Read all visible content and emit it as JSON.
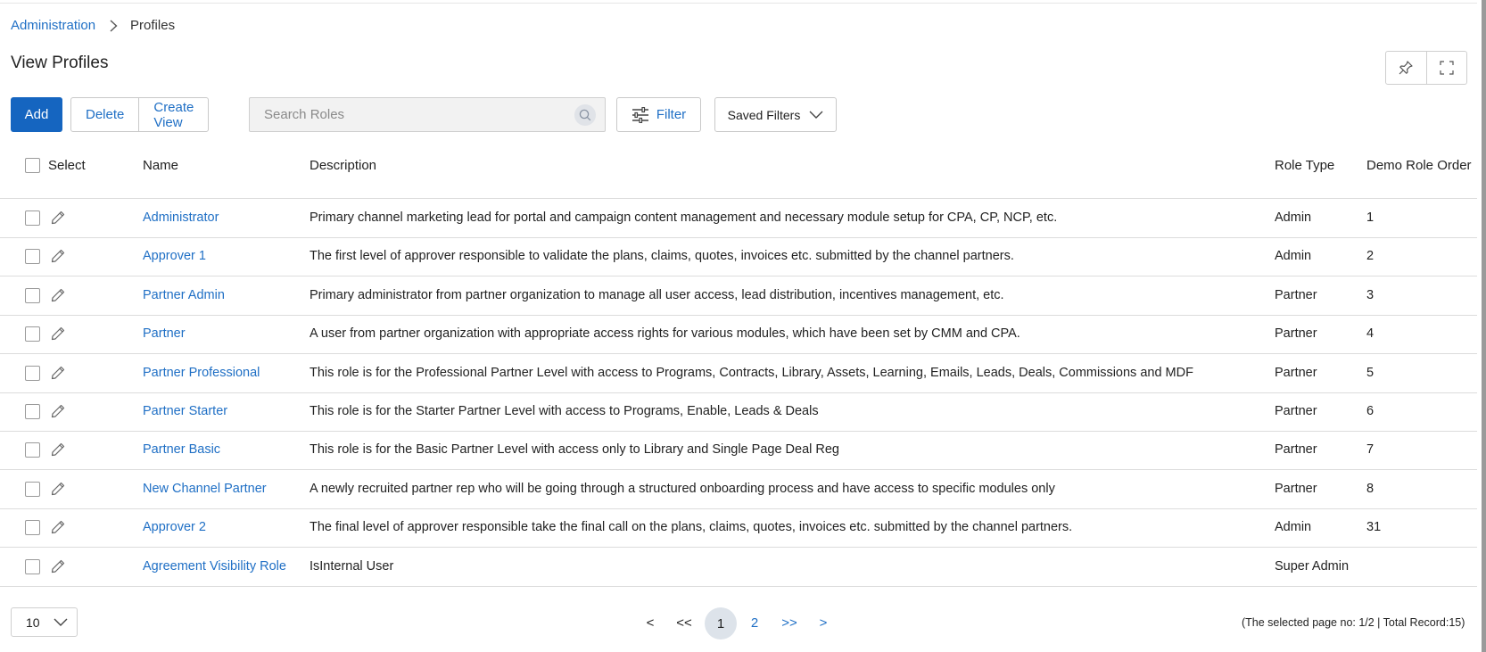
{
  "breadcrumb": {
    "parent": "Administration",
    "current": "Profiles"
  },
  "page_title": "View Profiles",
  "toolbar": {
    "add_label": "Add",
    "delete_label": "Delete",
    "create_view_label": "Create View",
    "search_placeholder": "Search Roles",
    "filter_label": "Filter",
    "saved_filters_label": "Saved Filters"
  },
  "table": {
    "headers": {
      "select": "Select",
      "name": "Name",
      "description": "Description",
      "role_type": "Role Type",
      "demo_role_order": "Demo Role Order"
    },
    "rows": [
      {
        "name": "Administrator",
        "description": "Primary channel marketing lead for portal and campaign content management and necessary module setup for CPA, CP, NCP, etc.",
        "role_type": "Admin",
        "order": "1"
      },
      {
        "name": "Approver 1",
        "description": "The first level of approver responsible to validate the plans, claims, quotes, invoices etc. submitted by the channel partners.",
        "role_type": "Admin",
        "order": "2"
      },
      {
        "name": "Partner Admin",
        "description": "Primary administrator from partner organization to manage all user access, lead distribution, incentives management, etc.",
        "role_type": "Partner",
        "order": "3"
      },
      {
        "name": "Partner",
        "description": "A user from partner organization with appropriate access rights for various modules, which have been set by CMM and CPA.",
        "role_type": "Partner",
        "order": "4"
      },
      {
        "name": "Partner Professional",
        "description": "This role is for the Professional Partner Level with access to Programs, Contracts, Library, Assets, Learning, Emails, Leads, Deals, Commissions and MDF",
        "role_type": "Partner",
        "order": "5"
      },
      {
        "name": "Partner Starter",
        "description": "This role is for the Starter Partner Level with access to Programs, Enable, Leads & Deals",
        "role_type": "Partner",
        "order": "6"
      },
      {
        "name": "Partner Basic",
        "description": "This role is for the Basic Partner Level with access only to Library and Single Page Deal Reg",
        "role_type": "Partner",
        "order": "7"
      },
      {
        "name": "New Channel Partner",
        "description": "A newly recruited partner rep who will be going through a structured onboarding process and have access to specific modules only",
        "role_type": "Partner",
        "order": "8"
      },
      {
        "name": "Approver 2",
        "description": "The final level of approver responsible take the final call on the plans, claims, quotes, invoices etc. submitted by the channel partners.",
        "role_type": "Admin",
        "order": "31"
      },
      {
        "name": "Agreement Visibility Role",
        "description": "IsInternal User",
        "role_type": "Super Admin",
        "order": ""
      }
    ]
  },
  "pagination": {
    "page_size": "10",
    "prev": "<",
    "first": "<<",
    "pages": [
      "1",
      "2"
    ],
    "last": ">>",
    "next": ">",
    "info": "(The selected page no: 1/2 | Total Record:15)"
  },
  "colors": {
    "primary": "#1565c0",
    "link": "#1f6fc5",
    "active_page_bg": "#dde3ea"
  }
}
